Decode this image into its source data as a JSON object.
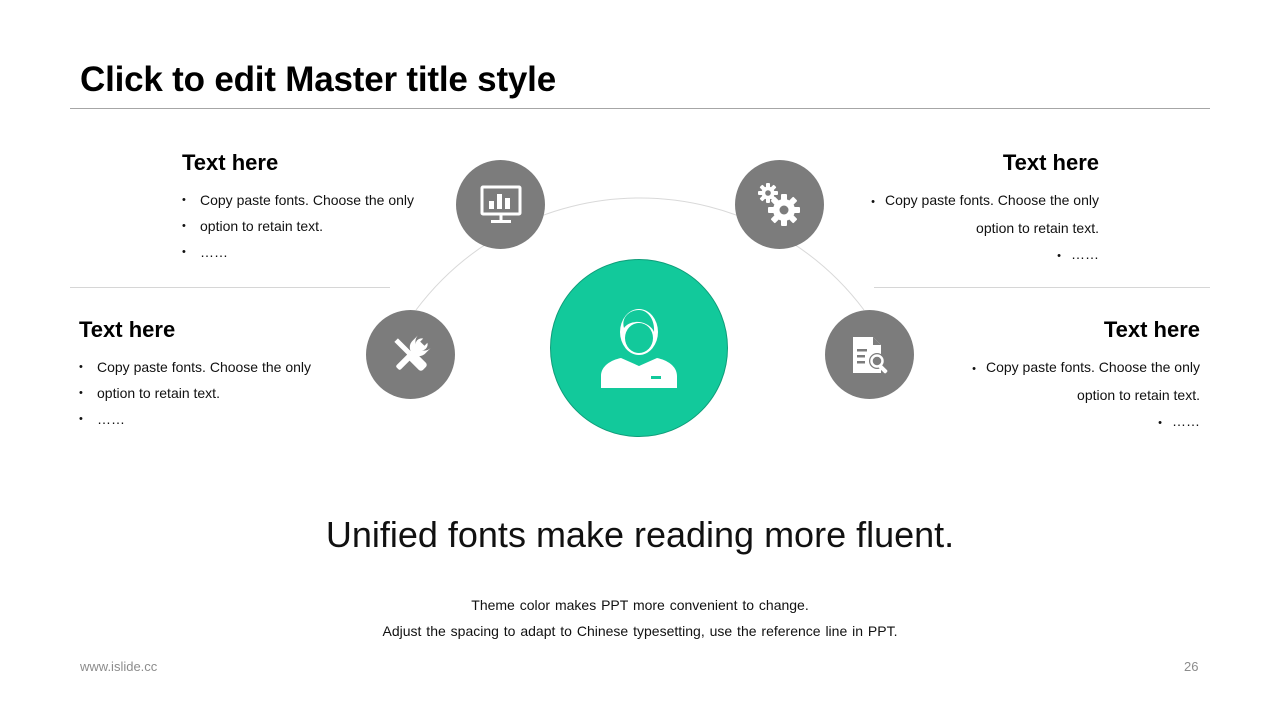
{
  "slide": {
    "title": "Click to edit Master title style",
    "headline": "Unified fonts make reading more fluent.",
    "sub_line_1": "Theme color makes PPT more convenient  to change.",
    "sub_line_2": "Adjust the spacing to adapt to Chinese  typesetting,  use the reference line  in PPT.",
    "footer_url": "www.islide.cc",
    "page_number": "26"
  },
  "blocks": [
    {
      "heading": "Text here",
      "line_1": "Copy paste fonts. Choose the only",
      "line_2": "option to retain text.",
      "line_3": "……"
    },
    {
      "heading": "Text here",
      "line_1": "Copy paste fonts. Choose the only",
      "line_2": "option to retain text.",
      "line_3": "……"
    },
    {
      "heading": "Text here",
      "line_1": "Copy paste fonts. Choose the only",
      "line_2": "option to retain text.",
      "line_3": "……"
    },
    {
      "heading": "Text here",
      "line_1": "Copy paste fonts. Choose the only",
      "line_2": "option to retain text.",
      "line_3": "……"
    }
  ],
  "icons": {
    "top_left": "presentation-chart-icon",
    "bottom_left": "tools-icon",
    "top_right": "gears-icon",
    "bottom_right": "document-search-icon",
    "center": "user-icon"
  },
  "colors": {
    "accent": "#12c99b",
    "accent_border": "#0e9d79",
    "icon_circle": "#7c7c7c",
    "rule": "#d6d6d6"
  }
}
